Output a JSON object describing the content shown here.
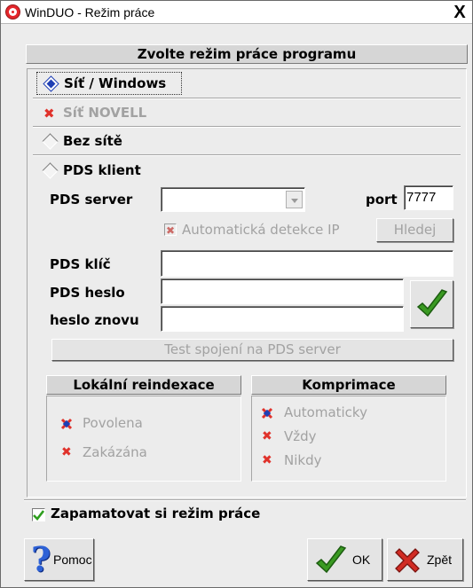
{
  "window": {
    "title": "WinDUO - Režim práce",
    "close_glyph": "X",
    "app_icon": "red-ring-icon"
  },
  "header": {
    "title": "Zvolte režim práce programu"
  },
  "modes": [
    {
      "label": "Síť / Windows",
      "mnemonic": "W",
      "selected": true,
      "enabled": true
    },
    {
      "label": "Síť NOVELL",
      "mnemonic": "N",
      "selected": false,
      "enabled": false
    },
    {
      "label": "Bez sítě",
      "mnemonic": "B",
      "selected": false,
      "enabled": true
    },
    {
      "label": "PDS klient",
      "mnemonic": "P",
      "selected": false,
      "enabled": true
    }
  ],
  "pds": {
    "server_label": "PDS server",
    "server_value": "",
    "port_label": "port",
    "port_value": "7777",
    "autodetect_label": "Automatická detekce IP",
    "autodetect_checked": false,
    "find_button": "Hledej",
    "key_label": "PDS klíč",
    "key_value": "",
    "password_label": "PDS heslo",
    "password_value": "",
    "password_repeat_label": "heslo znovu",
    "password_repeat_value": "",
    "test_button": "Test spojení na PDS server"
  },
  "reindex": {
    "title": "Lokální reindexace",
    "options": [
      {
        "label": "Povolena",
        "selected": true
      },
      {
        "label": "Zakázána",
        "selected": false
      }
    ]
  },
  "compress": {
    "title": "Komprimace",
    "options": [
      {
        "label": "Automaticky",
        "selected": true
      },
      {
        "label": "Vždy",
        "selected": false
      },
      {
        "label": "Nikdy",
        "selected": false
      }
    ]
  },
  "remember": {
    "label": "Zapamatovat si režim práce",
    "checked": true
  },
  "buttons": {
    "help": "Pomoc",
    "ok": "OK",
    "back": "Zpět"
  },
  "colors": {
    "accent_red": "#e0322b",
    "selection_blue": "#1f3fb4",
    "check_green": "#2e9e1e",
    "disabled_gray": "#a2a2a2"
  }
}
